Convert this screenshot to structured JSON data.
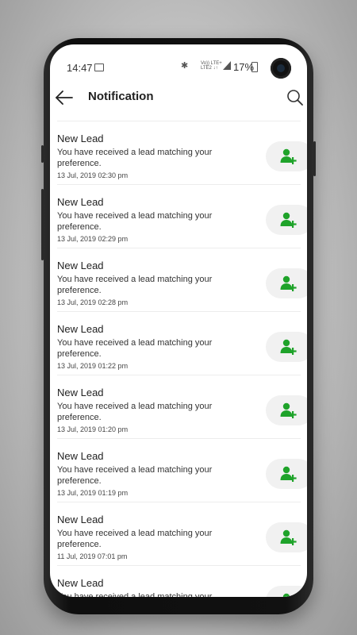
{
  "status_bar": {
    "time": "14:47",
    "network_text": "Vo)) LTE+ LTE2 ↓↑",
    "battery": "17%"
  },
  "header": {
    "title": "Notification"
  },
  "icons": {
    "back": "arrow-left-icon",
    "search": "search-icon",
    "action": "add-user-icon"
  },
  "colors": {
    "accent": "#1fa32a",
    "action_bg": "#f1f1f1"
  },
  "notifications": [
    {
      "title": "New Lead",
      "message": "You have received a lead matching your preference.",
      "date": "13 Jul, 2019 02:30 pm"
    },
    {
      "title": "New Lead",
      "message": "You have received a lead matching your preference.",
      "date": "13 Jul, 2019 02:29 pm"
    },
    {
      "title": "New Lead",
      "message": "You have received a lead matching your preference.",
      "date": "13 Jul, 2019 02:28 pm"
    },
    {
      "title": "New Lead",
      "message": "You have received a lead matching your preference.",
      "date": "13 Jul, 2019 01:22 pm"
    },
    {
      "title": "New Lead",
      "message": "You have received a lead matching your preference.",
      "date": "13 Jul, 2019 01:20 pm"
    },
    {
      "title": "New Lead",
      "message": "You have received a lead matching your preference.",
      "date": "13 Jul, 2019 01:19 pm"
    },
    {
      "title": "New Lead",
      "message": "You have received a lead matching your preference.",
      "date": "11 Jul, 2019 07:01 pm"
    },
    {
      "title": "New Lead",
      "message": "You have received a lead matching your",
      "date": ""
    }
  ]
}
